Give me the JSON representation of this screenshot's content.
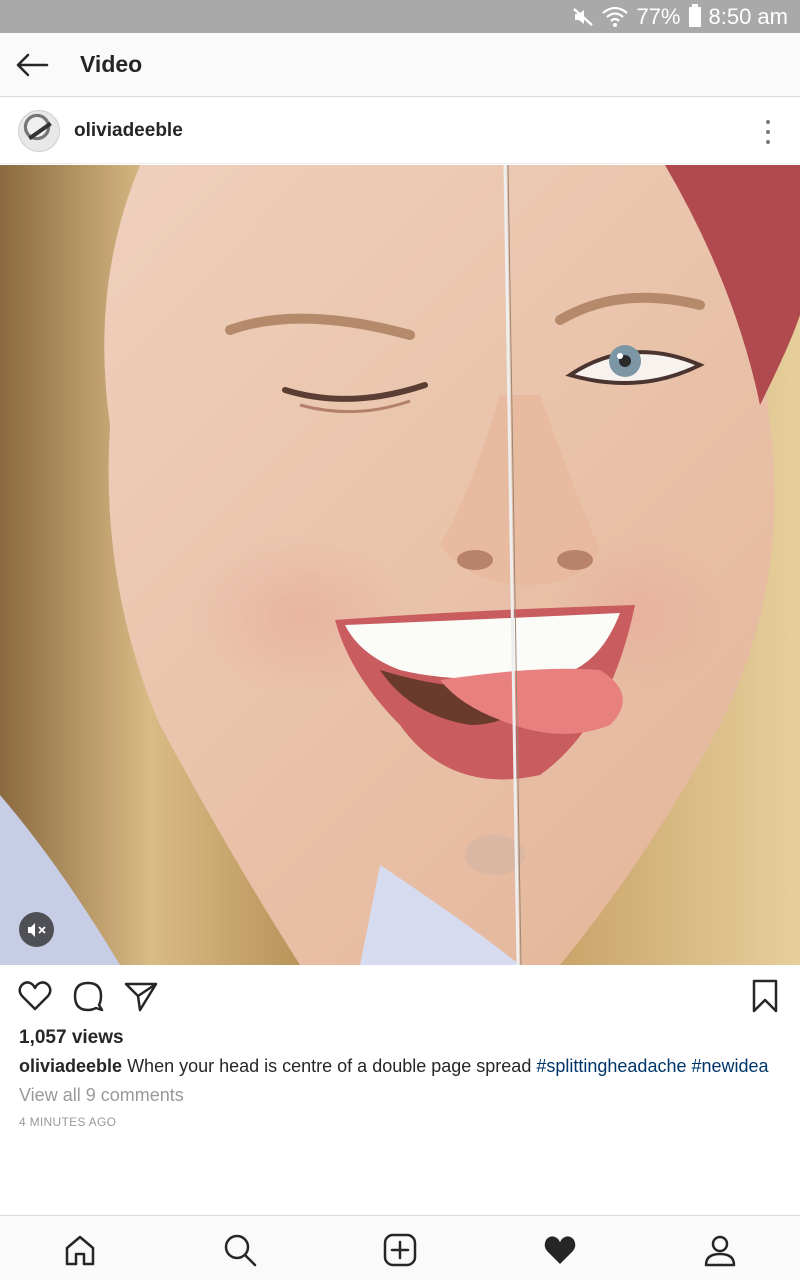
{
  "status_bar": {
    "battery": "77%",
    "time": "8:50 am",
    "icons": [
      "mute-icon",
      "wifi-icon",
      "battery-icon"
    ]
  },
  "app_bar": {
    "title": "Video",
    "back_icon": "arrow-left-icon"
  },
  "post": {
    "username": "oliviadeeble",
    "more_icon": "more-vertical-icon",
    "mute_icon": "muted-speaker-icon",
    "views": "1,057 views",
    "caption": {
      "username": "oliviadeeble",
      "text": "When your head is centre of a double page spread",
      "hashtags": [
        "#splittingheadache",
        "#newidea"
      ]
    },
    "view_comments": "View all 9 comments",
    "timestamp": "4 MINUTES AGO"
  },
  "actions": {
    "icons": [
      "heart-outline-icon",
      "comment-icon",
      "share-icon",
      "bookmark-icon"
    ]
  },
  "bottom_nav": {
    "items": [
      "home-icon",
      "search-icon",
      "add-post-icon",
      "activity-heart-icon",
      "profile-icon"
    ]
  },
  "colors": {
    "hashtag": "#003569",
    "secondary_text": "#999999",
    "status_bar": "#a9a9a9"
  }
}
